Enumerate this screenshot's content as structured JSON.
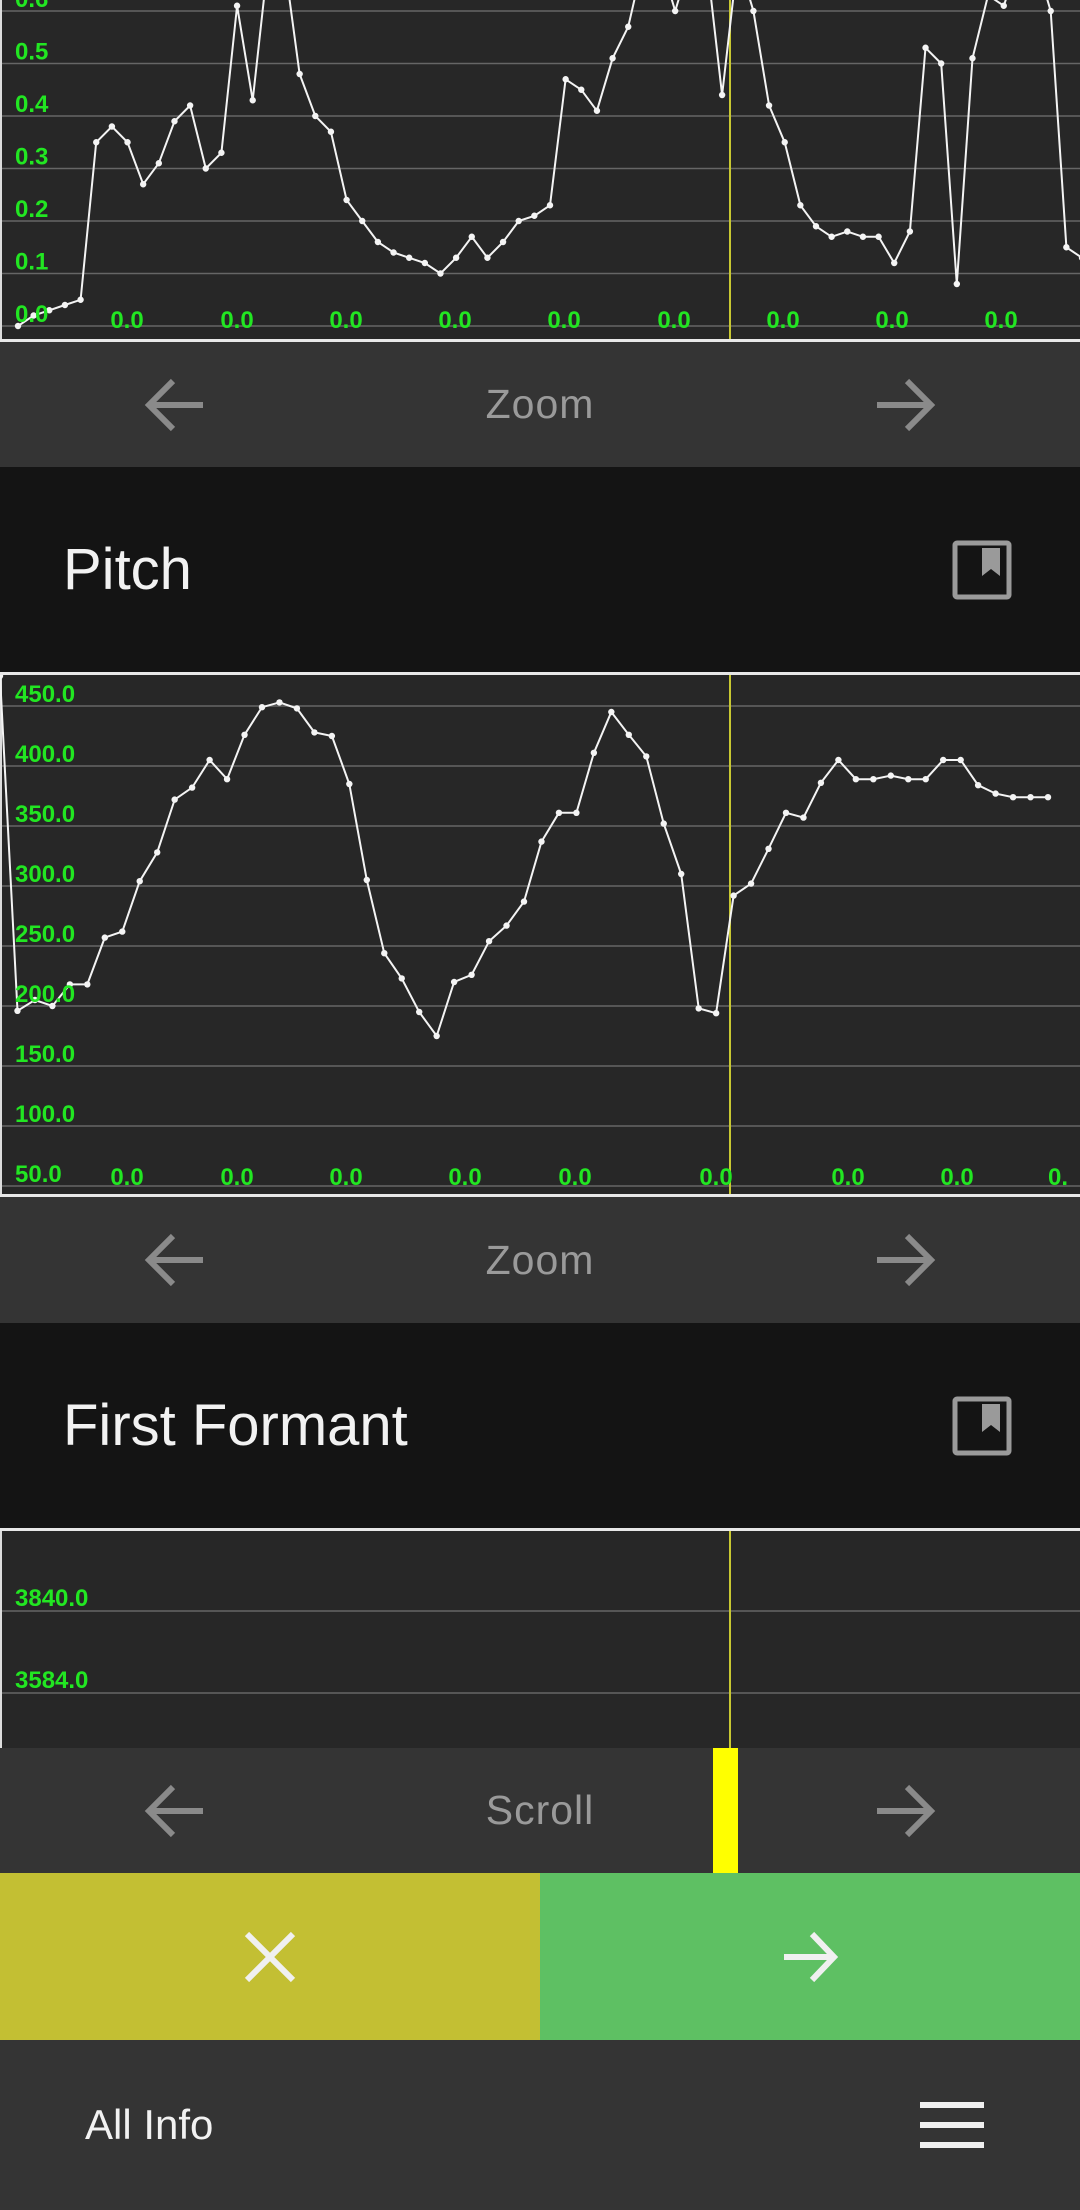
{
  "amplitude_chart": {
    "y_ticks": [
      "0.0",
      "0.1",
      "0.2",
      "0.3",
      "0.4",
      "0.5",
      "0.6"
    ],
    "x_ticks": [
      "0.0",
      "0.0",
      "0.0",
      "0.0",
      "0.0",
      "0.0",
      "0.0",
      "0.0",
      "0.0"
    ],
    "zoom_label": "Zoom"
  },
  "pitch": {
    "title": "Pitch",
    "y_ticks": [
      "50.0",
      "100.0",
      "150.0",
      "200.0",
      "250.0",
      "300.0",
      "350.0",
      "400.0",
      "450.0"
    ],
    "x_ticks": [
      "0.0",
      "0.0",
      "0.0",
      "0.0",
      "0.0",
      "0.0",
      "0.0",
      "0.0",
      "0."
    ],
    "zoom_label": "Zoom"
  },
  "first_formant": {
    "title": "First Formant",
    "y_ticks": [
      "3840.0",
      "3584.0"
    ],
    "scroll_label": "Scroll"
  },
  "actions": {
    "cancel_icon": "close-icon",
    "next_icon": "arrow-right-icon"
  },
  "bottom_bar": {
    "title": "All Info",
    "menu_icon": "hamburger-menu-icon"
  },
  "colors": {
    "plot_bg": "#272727",
    "axis_text": "#22e622",
    "cursor": "#c8c832",
    "cancel_bg": "#c3bf33",
    "next_bg": "#5ec063",
    "scroll_thumb": "#ffff00"
  },
  "chart_data": [
    {
      "type": "line",
      "ylim": [
        0,
        0.6
      ],
      "x_tick_labels": [
        "0.0",
        "0.0",
        "0.0",
        "0.0",
        "0.0",
        "0.0",
        "0.0",
        "0.0",
        "0.0"
      ],
      "series": [
        {
          "values": [
            0.0,
            0.02,
            0.03,
            0.04,
            0.05,
            0.35,
            0.38,
            0.35,
            0.27,
            0.31,
            0.39,
            0.42,
            0.3,
            0.33,
            0.61,
            0.43,
            0.7,
            0.7,
            0.48,
            0.4,
            0.37,
            0.24,
            0.2,
            0.16,
            0.14,
            0.13,
            0.12,
            0.1,
            0.13,
            0.17,
            0.13,
            0.16,
            0.2,
            0.21,
            0.23,
            0.47,
            0.45,
            0.41,
            0.51,
            0.57,
            0.7,
            0.7,
            0.6,
            0.7,
            0.7,
            0.44,
            0.7,
            0.6,
            0.42,
            0.35,
            0.23,
            0.19,
            0.17,
            0.18,
            0.17,
            0.17,
            0.12,
            0.18,
            0.53,
            0.5,
            0.08,
            0.51,
            0.63,
            0.61,
            0.7,
            0.7,
            0.6,
            0.15,
            0.13
          ]
        }
      ]
    },
    {
      "type": "line",
      "ylim": [
        50,
        475
      ],
      "x_tick_labels": [
        "0.0",
        "0.0",
        "0.0",
        "0.0",
        "0.0",
        "0.0",
        "0.0",
        "0.0",
        "0."
      ],
      "series": [
        {
          "values": [
            475,
            196,
            205,
            200,
            218,
            218,
            257,
            262,
            304,
            328,
            372,
            382,
            405,
            389,
            426,
            449,
            453,
            448,
            428,
            425,
            385,
            305,
            244,
            223,
            195,
            175,
            220,
            226,
            254,
            267,
            287,
            337,
            361,
            361,
            411,
            445,
            426,
            408,
            352,
            310,
            198,
            194,
            292,
            302,
            331,
            361,
            357,
            386,
            405,
            389,
            389,
            392,
            389,
            389,
            405,
            405,
            384,
            377,
            374,
            374,
            374
          ]
        }
      ]
    }
  ]
}
